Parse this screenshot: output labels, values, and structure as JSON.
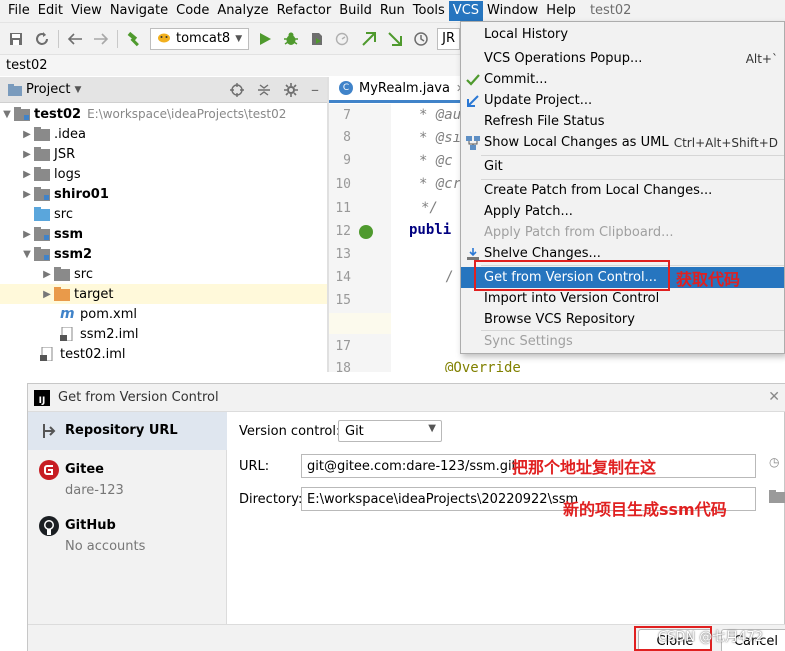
{
  "menubar": {
    "items": [
      "File",
      "Edit",
      "View",
      "Navigate",
      "Code",
      "Analyze",
      "Refactor",
      "Build",
      "Run",
      "Tools",
      "VCS",
      "Window",
      "Help"
    ],
    "project": "test02"
  },
  "toolbar": {
    "run_config": "tomcat8",
    "jr_label": "JR"
  },
  "navbar": {
    "breadcrumb": "test02"
  },
  "project_panel": {
    "title": "Project",
    "tree": [
      {
        "label": "test02",
        "path": "E:\\workspace\\ideaProjects\\test02"
      },
      {
        "label": ".idea"
      },
      {
        "label": "JSR"
      },
      {
        "label": "logs"
      },
      {
        "label": "shiro01"
      },
      {
        "label": "src"
      },
      {
        "label": "ssm"
      },
      {
        "label": "ssm2"
      },
      {
        "label": "src"
      },
      {
        "label": "target"
      },
      {
        "label": "pom.xml"
      },
      {
        "label": "ssm2.iml"
      },
      {
        "label": "test02.iml"
      }
    ]
  },
  "editor": {
    "tab": "MyRealm.java",
    "line_numbers": [
      "7",
      "8",
      "9",
      "10",
      "11",
      "12",
      "13",
      "14",
      "15",
      "16",
      "17",
      "18"
    ],
    "lines": [
      "* @au",
      "* @sı",
      "* @c",
      "* @cr",
      "*/",
      "publi",
      "",
      "/",
      "",
      "",
      "",
      "@Override"
    ]
  },
  "vcs_menu": {
    "items": [
      {
        "label": "Local History",
        "shortcut": ""
      },
      {
        "label": "VCS Operations Popup...",
        "shortcut": "Alt+`"
      },
      {
        "label": "Commit...",
        "shortcut": ""
      },
      {
        "label": "Update Project...",
        "shortcut": ""
      },
      {
        "label": "Refresh File Status",
        "shortcut": ""
      },
      {
        "label": "Show Local Changes as UML",
        "shortcut": "Ctrl+Alt+Shift+D"
      },
      {
        "label": "Git",
        "shortcut": ""
      },
      {
        "label": "Create Patch from Local Changes...",
        "shortcut": ""
      },
      {
        "label": "Apply Patch...",
        "shortcut": ""
      },
      {
        "label": "Apply Patch from Clipboard...",
        "shortcut": ""
      },
      {
        "label": "Shelve Changes...",
        "shortcut": ""
      },
      {
        "label": "Get from Version Control...",
        "shortcut": ""
      },
      {
        "label": "Import into Version Control",
        "shortcut": ""
      },
      {
        "label": "Browse VCS Repository",
        "shortcut": ""
      },
      {
        "label": "Sync Settings",
        "shortcut": ""
      }
    ]
  },
  "dialog": {
    "title": "Get from Version Control",
    "sidebar": [
      {
        "name": "Repository URL",
        "sub": ""
      },
      {
        "name": "Gitee",
        "sub": "dare-123"
      },
      {
        "name": "GitHub",
        "sub": "No accounts"
      }
    ],
    "version_control_label": "Version control:",
    "version_control_value": "Git",
    "url_label": "URL:",
    "url_value": "git@gitee.com:dare-123/ssm.git",
    "directory_label": "Directory:",
    "directory_value": "E:\\workspace\\ideaProjects\\20220922\\ssm",
    "clone_button": "Clone",
    "cancel_button": "Cancel"
  },
  "annotations": {
    "get_code": "获取代码",
    "paste_here": "把那个地址复制在这",
    "new_project": "新的项目生成ssm代码"
  },
  "watermark": "CSDN @七月472",
  "colors": {
    "accent": "#2675bf",
    "annotation": "#e02020",
    "selection": "#fff9da"
  }
}
